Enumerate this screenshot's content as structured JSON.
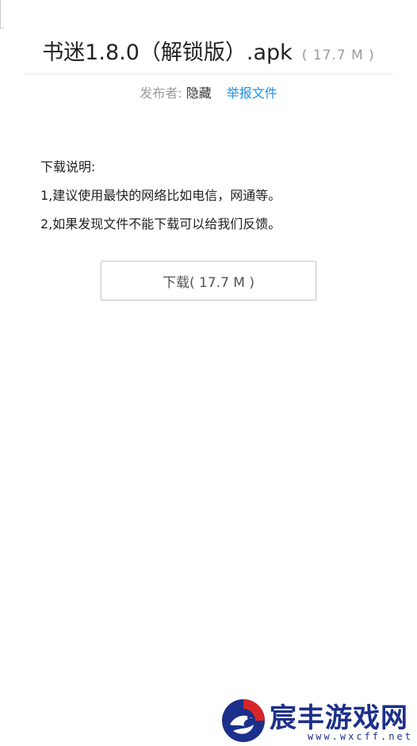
{
  "file": {
    "title": "书迷1.8.0（解锁版）.apk",
    "size": "( 17.7 M )"
  },
  "publisher": {
    "label": "发布者:",
    "value": "隐藏",
    "report_link": "举报文件"
  },
  "notes": {
    "heading": "下载说明:",
    "lines": [
      "1,建议使用最快的网络比如电信，网通等。",
      "2,如果发现文件不能下载可以给我们反馈。"
    ]
  },
  "download_button": {
    "label": "下载( 17.7 M )"
  },
  "watermark": {
    "name": "宸丰游戏网",
    "url": "www.wxcff.net",
    "colors": {
      "primary": "#1c2f8a",
      "accent": "#d7262a"
    },
    "icon": "dragon-logo-icon"
  },
  "colors": {
    "link": "#1e90e6",
    "muted": "#9a9a9a",
    "text": "#222222"
  }
}
